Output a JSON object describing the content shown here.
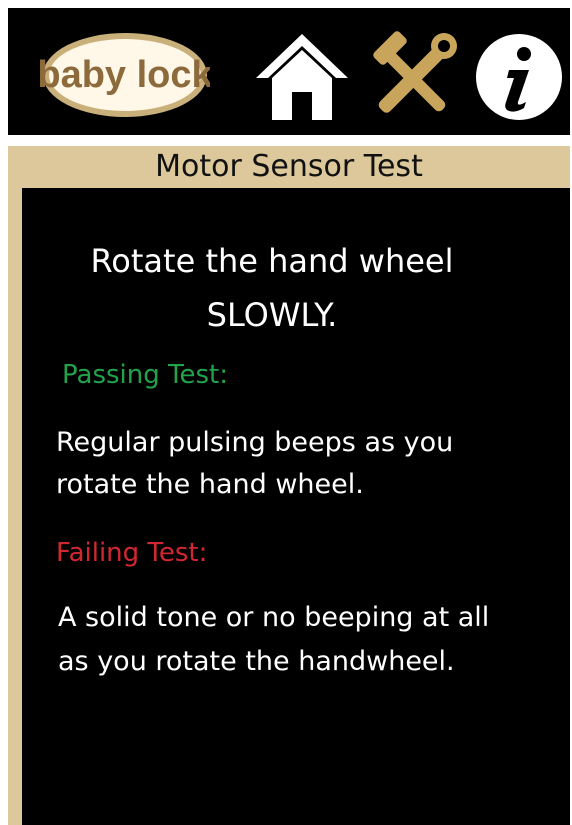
{
  "header": {
    "logo_text": "baby lock",
    "icons": [
      "home-icon",
      "tools-icon",
      "info-icon"
    ]
  },
  "panel": {
    "title": "Motor Sensor Test",
    "instruction_line1": "Rotate the hand wheel",
    "instruction_line2": "SLOWLY.",
    "passing_label": "Passing Test:",
    "passing_desc": "Regular pulsing beeps as you rotate the hand wheel.",
    "failing_label": "Failing Test:",
    "failing_desc": "A solid tone or no beeping at all as you rotate the handwheel."
  },
  "colors": {
    "frame": "#dcc89a",
    "background": "#000000",
    "pass": "#22a34b",
    "fail": "#d22730",
    "tools": "#c8a55a"
  }
}
